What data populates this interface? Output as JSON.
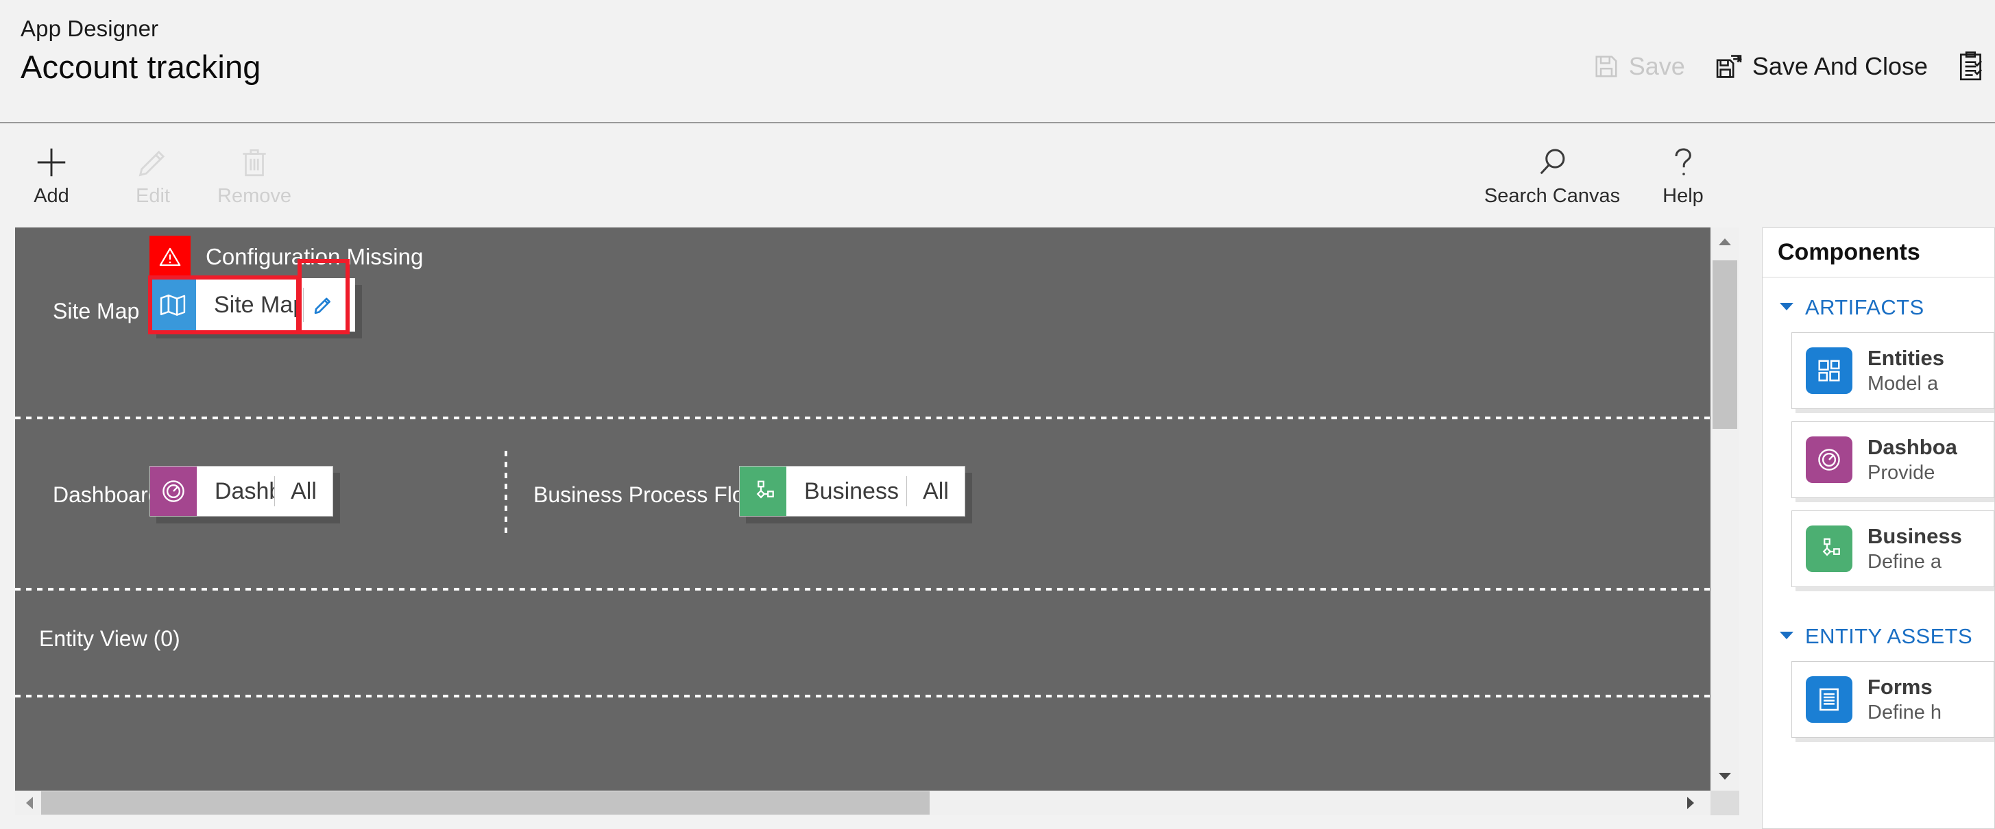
{
  "header": {
    "app_label": "App Designer",
    "title": "Account tracking",
    "commands": [
      {
        "label": "Save",
        "icon": "save-icon",
        "disabled": true
      },
      {
        "label": "Save And Close",
        "icon": "save-and-close-icon",
        "disabled": false
      },
      {
        "label": "",
        "icon": "validate-clipboard-icon",
        "disabled": false
      }
    ]
  },
  "toolbar": {
    "add_label": "Add",
    "edit_label": "Edit",
    "remove_label": "Remove",
    "search_canvas_label": "Search Canvas",
    "help_label": "Help"
  },
  "canvas": {
    "warning": {
      "text": "Configuration Missing",
      "icon": "warning-triangle-icon",
      "color": "#ff0000"
    },
    "rows": [
      {
        "label": "Site Map",
        "tile": {
          "name": "Site Map",
          "icon": "map-icon",
          "icon_color": "#3998db",
          "action_icon": "pencil-edit-icon",
          "action_color": "#1e7fd4"
        }
      },
      {
        "label": "Dashboards",
        "tile": {
          "name": "Dashboards",
          "icon": "gauge-icon",
          "icon_color": "#a4468f",
          "filter": "All"
        }
      },
      {
        "label": "Business Process Flows",
        "tile": {
          "name": "Business Proces...",
          "icon": "process-flow-icon",
          "icon_color": "#4caf72",
          "filter": "All"
        }
      },
      {
        "label": "Entity View (0)"
      }
    ],
    "highlight_color": "#ef1c2a"
  },
  "components": {
    "header": "Components",
    "sections": [
      {
        "title": "ARTIFACTS",
        "expanded": true,
        "cards": [
          {
            "title": "Entities",
            "desc": "Model a",
            "icon": "entities-icon",
            "color": "#1b7fd4"
          },
          {
            "title": "Dashboa",
            "desc": "Provide",
            "icon": "gauge-icon",
            "color": "#a4468f"
          },
          {
            "title": "Business",
            "desc": "Define a",
            "icon": "process-flow-icon",
            "color": "#4caf72"
          }
        ]
      },
      {
        "title": "ENTITY ASSETS",
        "expanded": true,
        "cards": [
          {
            "title": "Forms",
            "desc": "Define h",
            "icon": "forms-icon",
            "color": "#1b7fd4"
          }
        ]
      }
    ]
  }
}
